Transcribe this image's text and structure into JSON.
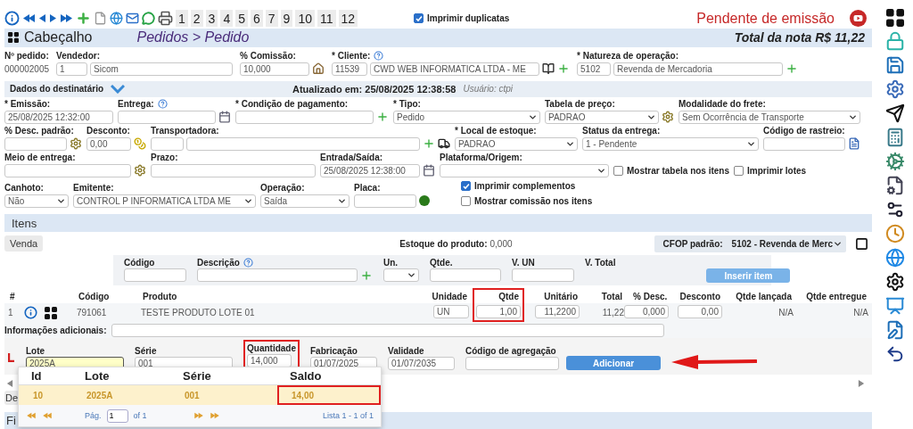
{
  "toolbar": {
    "pages": [
      "1",
      "2",
      "3",
      "4",
      "5",
      "6",
      "7",
      "9",
      "10",
      "11",
      "12"
    ],
    "print_duplicates": {
      "label": "Imprimir duplicatas",
      "checked": true
    }
  },
  "status": "Pendente de emissão",
  "header": {
    "title": "Cabeçalho",
    "breadcrumb": "Pedidos > Pedido",
    "total": "Total da nota R$ 11,22"
  },
  "main_fields": [
    {
      "kind": "text",
      "label": "Nº pedido:",
      "value": "000002005"
    },
    {
      "kind": "pair",
      "label": "Vendedor:",
      "code": "1",
      "value": "Sicom"
    },
    {
      "kind": "input",
      "label": "% Comissão:",
      "value": "10,000"
    },
    {
      "kind": "pair",
      "label": "* Cliente:",
      "help": true,
      "code": "11539",
      "value": "CWD WEB INFORMATICA LTDA - ME"
    },
    {
      "kind": "pair",
      "label": "* Natureza de operação:",
      "code": "5102",
      "value": "Revenda de Mercadoria"
    }
  ],
  "recipient_bar": {
    "title": "Dados do destinatário",
    "updated": "Atualizado em: 25/08/2025 12:38:58",
    "user": "Usuário: ctpi"
  },
  "form_rows": [
    {
      "fields": [
        {
          "kind": "input",
          "label": "* Emissão:",
          "value": "25/08/2025 12:32:00"
        },
        {
          "kind": "date",
          "label": "Entrega:",
          "help": true
        },
        {
          "kind": "input",
          "label": "* Condição de pagamento:"
        },
        {
          "kind": "select",
          "label": "* Tipo:",
          "value": "Pedido"
        },
        {
          "kind": "select",
          "label": "Tabela de preço:",
          "value": "PADRAO"
        },
        {
          "kind": "select",
          "label": "Modalidade do frete:",
          "value": "Sem Ocorrência de Transporte"
        }
      ]
    },
    {
      "fields": [
        {
          "kind": "input",
          "label": "% Desc. padrão:"
        },
        {
          "kind": "input",
          "label": "Desconto:",
          "value": "0,00"
        },
        {
          "kind": "pair",
          "label": "Transportadora:"
        },
        {
          "kind": "select",
          "label": "* Local de estoque:",
          "value": "PADRAO"
        },
        {
          "kind": "select",
          "label": "Status da entrega:",
          "value": "1 - Pendente"
        },
        {
          "kind": "input",
          "label": "Código de rastreio:"
        }
      ]
    },
    {
      "fields": [
        {
          "kind": "input",
          "label": "Meio de entrega:"
        },
        {
          "kind": "input",
          "label": "Prazo:"
        },
        {
          "kind": "date",
          "label": "Entrada/Saída:",
          "value": "25/08/2025 12:38:00"
        },
        {
          "kind": "select",
          "label": "Plataforma/Origem:"
        },
        {
          "kind": "checkbox",
          "label": "Mostrar tabela nos itens",
          "checked": false
        },
        {
          "kind": "checkbox",
          "label": "Imprimir lotes",
          "checked": false
        }
      ]
    },
    {
      "fields": [
        {
          "kind": "select",
          "label": "Canhoto:",
          "value": "Não"
        },
        {
          "kind": "select",
          "label": "Emitente:",
          "value": "CONTROL P INFORMATICA LTDA ME"
        },
        {
          "kind": "select",
          "label": "Operação:",
          "value": "Saída"
        },
        {
          "kind": "input",
          "label": "Placa:"
        },
        {
          "kind": "checkgroup",
          "items": [
            {
              "label": "Imprimir complementos",
              "checked": true
            },
            {
              "label": "Mostrar comissão nos itens",
              "checked": false
            }
          ]
        }
      ]
    }
  ],
  "items": {
    "title": "Itens",
    "tab": "Venda",
    "stock_label": "Estoque do produto:",
    "stock_value": "0,000",
    "cfop_label": "CFOP padrão:",
    "cfop_value": "5102 - Revenda de Merc"
  },
  "insert_form": {
    "fields": [
      {
        "kind": "input",
        "label": "Código"
      },
      {
        "kind": "input",
        "label": "Descrição",
        "help": true
      },
      {
        "kind": "select",
        "label": "Un."
      },
      {
        "kind": "input",
        "label": "Qtde."
      },
      {
        "kind": "input",
        "label": "V. UN"
      },
      {
        "kind": "text",
        "label": "V. Total"
      }
    ],
    "button": "Inserir item",
    "disabled": true
  },
  "items_table": {
    "columns": [
      {
        "label": "#",
        "highlighted": false
      },
      {
        "label": "Código",
        "highlighted": false
      },
      {
        "label": "Produto",
        "highlighted": false
      },
      {
        "label": "Unidade",
        "highlighted": false
      },
      {
        "label": "Qtde",
        "highlighted": true
      },
      {
        "label": "Unitário",
        "highlighted": false
      },
      {
        "label": "Total",
        "highlighted": false
      },
      {
        "label": "% Desc.",
        "highlighted": false
      },
      {
        "label": "Desconto",
        "highlighted": false
      },
      {
        "label": "Qtde lançada",
        "highlighted": false
      },
      {
        "label": "Qtde entregue",
        "highlighted": false
      }
    ],
    "rows": [
      {
        "number": "1",
        "code": "791061",
        "product": "TESTE PRODUTO LOTE 01",
        "unit": "UN",
        "qty": "1,00",
        "unit_price": "11,2200",
        "total": "11,22",
        "disc_pct": "0,000",
        "discount": "0,00",
        "qty_posted": "N/A",
        "qty_delivered": "N/A"
      }
    ]
  },
  "additional_info": {
    "label": "Informações adicionais:"
  },
  "lot_form": {
    "fields": [
      {
        "label": "Lote",
        "value": "2025A",
        "focused": true,
        "highlighted": false
      },
      {
        "label": "Série",
        "value": "001",
        "focused": false,
        "highlighted": false
      },
      {
        "label": "Quantidade",
        "value": "14,000",
        "focused": false,
        "highlighted": true
      },
      {
        "label": "Fabricação",
        "value": "01/07/2025",
        "focused": false,
        "highlighted": false
      },
      {
        "label": "Validade",
        "value": "01/07/2035",
        "focused": false,
        "highlighted": false
      },
      {
        "label": "Código de agregação",
        "focused": false,
        "highlighted": false
      }
    ],
    "button": "Adicionar"
  },
  "bottom_button": "De",
  "bottom_bar": "Fi",
  "lot_popup": {
    "columns": [
      {
        "label": "Id",
        "highlighted": false
      },
      {
        "label": "Lote",
        "highlighted": false
      },
      {
        "label": "Série",
        "highlighted": false
      },
      {
        "label": "Saldo",
        "highlighted": true
      }
    ],
    "rows": [
      {
        "cells": [
          "10",
          "2025A",
          "001",
          "14,00"
        ],
        "selected": true
      }
    ],
    "pager": {
      "page_label": "Pág.",
      "page": "1",
      "of": "of 1",
      "summary": "Lista 1 - 1 of 1"
    }
  }
}
